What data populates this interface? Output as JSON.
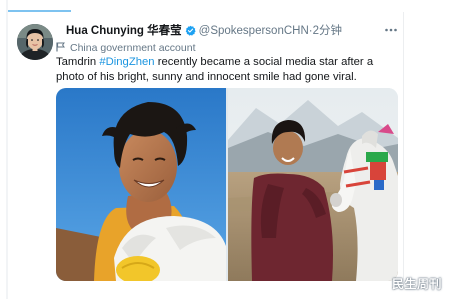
{
  "tweet": {
    "author": {
      "display_name": "Hua Chunying 华春莹",
      "handle": "@SpokespersonCHN",
      "separator": "·",
      "time": "2分钟",
      "verified": true,
      "avatar_icon": "avatar-portrait-icon"
    },
    "label": {
      "icon": "flag-icon",
      "text": "China government account"
    },
    "text": {
      "before_hashtag": "Tamdrin ",
      "hashtag": "#DingZhen",
      "after_hashtag": " recently became a social media star after a photo of his bright, sunny and innocent smile had gone viral."
    },
    "media": [
      {
        "description_icon": "photo-smiling-boy-icon"
      },
      {
        "description_icon": "photo-boy-with-horse-icon"
      }
    ],
    "menu_icon": "more-options-icon"
  },
  "watermark": {
    "text": "民生周刊"
  },
  "colors": {
    "link": "#1b95e0",
    "verified": "#1da1f2",
    "secondary_text": "#657786",
    "primary_text": "#14171a"
  }
}
